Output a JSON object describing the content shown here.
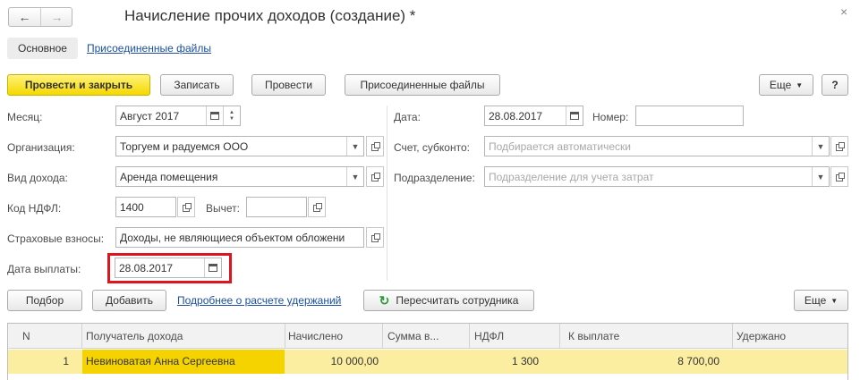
{
  "window": {
    "title": "Начисление прочих доходов (создание) *",
    "close_glyph": "×"
  },
  "nav": {
    "back_glyph": "←",
    "forward_glyph": "→"
  },
  "tabs": [
    {
      "label": "Основное"
    },
    {
      "label": "Присоединенные файлы"
    }
  ],
  "toolbar": {
    "post_close_label": "Провести и закрыть",
    "save_label": "Записать",
    "post_label": "Провести",
    "files_label": "Присоединенные файлы",
    "more_label": "Еще",
    "help_label": "?"
  },
  "form": {
    "month": {
      "label": "Месяц:",
      "value": "Август 2017"
    },
    "organization": {
      "label": "Организация:",
      "value": "Торгуем и радуемся ООО"
    },
    "income_type": {
      "label": "Вид дохода:",
      "value": "Аренда помещения"
    },
    "ndfl_code": {
      "label": "Код НДФЛ:",
      "value": "1400"
    },
    "deduction": {
      "label": "Вычет:",
      "value": ""
    },
    "insurance": {
      "label": "Страховые взносы:",
      "value": "Доходы, не являющиеся объектом обложени"
    },
    "payment_date": {
      "label": "Дата выплаты:",
      "value": "28.08.2017"
    },
    "date": {
      "label": "Дата:",
      "value": "28.08.2017"
    },
    "number": {
      "label": "Номер:",
      "value": ""
    },
    "account": {
      "label": "Счет, субконто:",
      "placeholder": "Подбирается автоматически"
    },
    "department": {
      "label": "Подразделение:",
      "placeholder": "Подразделение для учета затрат"
    }
  },
  "table_toolbar": {
    "select_label": "Подбор",
    "add_label": "Добавить",
    "details_link": "Подробнее о расчете удержаний",
    "recalc_label": "Пересчитать сотрудника",
    "more_label": "Еще"
  },
  "table": {
    "columns": [
      "N",
      "Получатель дохода",
      "Начислено",
      "Сумма в...",
      "НДФЛ",
      "К выплате",
      "Удержано"
    ],
    "rows": [
      {
        "n": "1",
        "recipient": "Невиноватая Анна Сергеевна",
        "accrued": "10 000,00",
        "sum": "",
        "ndfl": "1 300",
        "payout": "8 700,00",
        "withheld": ""
      }
    ]
  },
  "colors": {
    "primary_button": "#f5d800",
    "selected_row": "#fbeea0",
    "selected_cell": "#f5d300",
    "highlight_frame": "#e0141e",
    "link": "#1c4fa0"
  }
}
